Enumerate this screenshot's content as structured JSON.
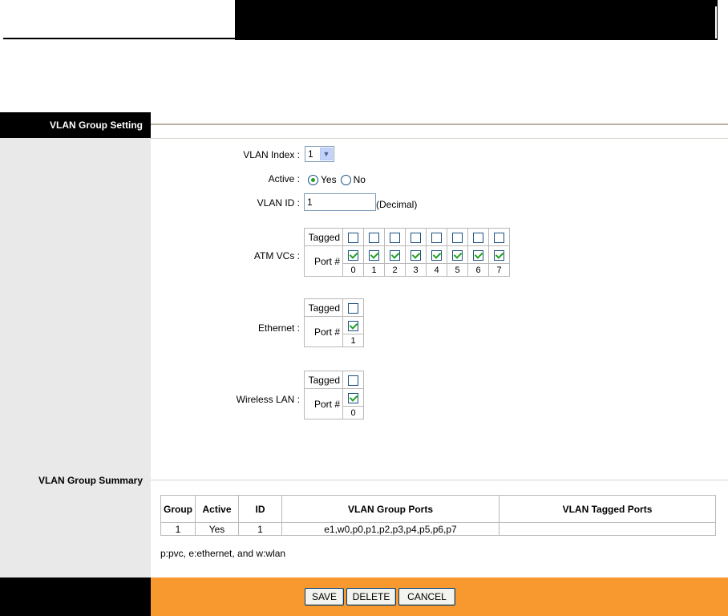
{
  "setting": {
    "section_title": "VLAN Group Setting",
    "vlan_index_label": "VLAN Index :",
    "vlan_index_value": "1",
    "active_label": "Active :",
    "active_yes": "Yes",
    "active_no": "No",
    "active_selected": "Yes",
    "vlan_id_label": "VLAN ID :",
    "vlan_id_value": "1",
    "vlan_id_hint": "(Decimal)",
    "atm": {
      "label": "ATM VCs :",
      "tagged_label": "Tagged",
      "port_label": "Port #",
      "ports": [
        "0",
        "1",
        "2",
        "3",
        "4",
        "5",
        "6",
        "7"
      ],
      "tagged_checked": [
        false,
        false,
        false,
        false,
        false,
        false,
        false,
        false
      ],
      "port_checked": [
        true,
        true,
        true,
        true,
        true,
        true,
        true,
        true
      ]
    },
    "ethernet": {
      "label": "Ethernet :",
      "tagged_label": "Tagged",
      "port_label": "Port #",
      "ports": [
        "1"
      ],
      "tagged_checked": [
        false
      ],
      "port_checked": [
        true
      ]
    },
    "wlan": {
      "label": "Wireless LAN :",
      "tagged_label": "Tagged",
      "port_label": "Port #",
      "ports": [
        "0"
      ],
      "tagged_checked": [
        false
      ],
      "port_checked": [
        true
      ]
    }
  },
  "summary": {
    "section_title": "VLAN Group Summary",
    "columns": [
      "Group",
      "Active",
      "ID",
      "VLAN Group Ports",
      "VLAN Tagged Ports"
    ],
    "rows": [
      [
        "1",
        "Yes",
        "1",
        "e1,w0,p0,p1,p2,p3,p4,p5,p6,p7",
        ""
      ]
    ],
    "note": "p:pvc, e:ethernet, and w:wlan"
  },
  "buttons": {
    "save": "SAVE",
    "delete": "DELETE",
    "cancel": "CANCEL"
  },
  "colors": {
    "accent_orange": "#f7992f",
    "sidebar_gray": "#e9e9e9",
    "check_green": "#21a121"
  }
}
